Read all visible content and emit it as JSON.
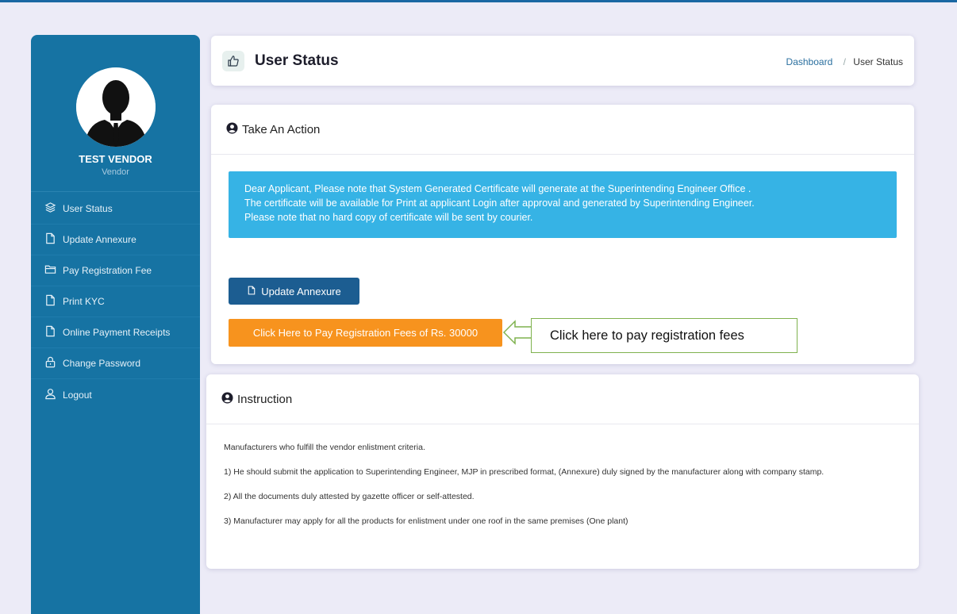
{
  "sidebar": {
    "user_name": "TEST VENDOR",
    "user_role": "Vendor",
    "items": [
      {
        "label": "User Status",
        "icon": "layers-icon"
      },
      {
        "label": "Update Annexure",
        "icon": "file-icon"
      },
      {
        "label": "Pay Registration Fee",
        "icon": "folder-icon"
      },
      {
        "label": "Print KYC",
        "icon": "file-icon"
      },
      {
        "label": "Online Payment Receipts",
        "icon": "file-icon"
      },
      {
        "label": "Change Password",
        "icon": "lock-icon"
      },
      {
        "label": "Logout",
        "icon": "user-icon"
      }
    ]
  },
  "header": {
    "title": "User Status",
    "breadcrumb": {
      "home": "Dashboard",
      "separator": "/",
      "current": "User Status"
    }
  },
  "action": {
    "title": "Take An Action",
    "alert_lines": [
      "Dear Applicant, Please note that System Generated Certificate will generate at the Superintending Engineer Office .",
      "The certificate will be available for Print at applicant Login after approval and generated by Superintending Engineer.",
      "Please note that no hard copy of certificate will be sent by courier."
    ],
    "update_button": "Update Annexure",
    "pay_button": "Click Here to Pay Registration Fees of Rs. 30000"
  },
  "callout": {
    "text": "Click here to pay registration fees"
  },
  "instruction": {
    "title": "Instruction",
    "lines": [
      "Manufacturers who fulfill the vendor enlistment criteria.",
      "1) He should submit the application to Superintending Engineer, MJP in prescribed format, (Annexure) duly signed by the manufacturer along with company stamp.",
      "2) All the documents duly attested by gazette officer or self-attested.",
      "3) Manufacturer may apply for all the products for enlistment under one roof in the same premises (One plant)"
    ]
  },
  "colors": {
    "sidebar": "#1673a3",
    "alert": "#36b3e5",
    "primary_button": "#1c5d91",
    "pay_button": "#f7931e",
    "callout_border": "#7fb24e",
    "background": "#ecebf7"
  }
}
